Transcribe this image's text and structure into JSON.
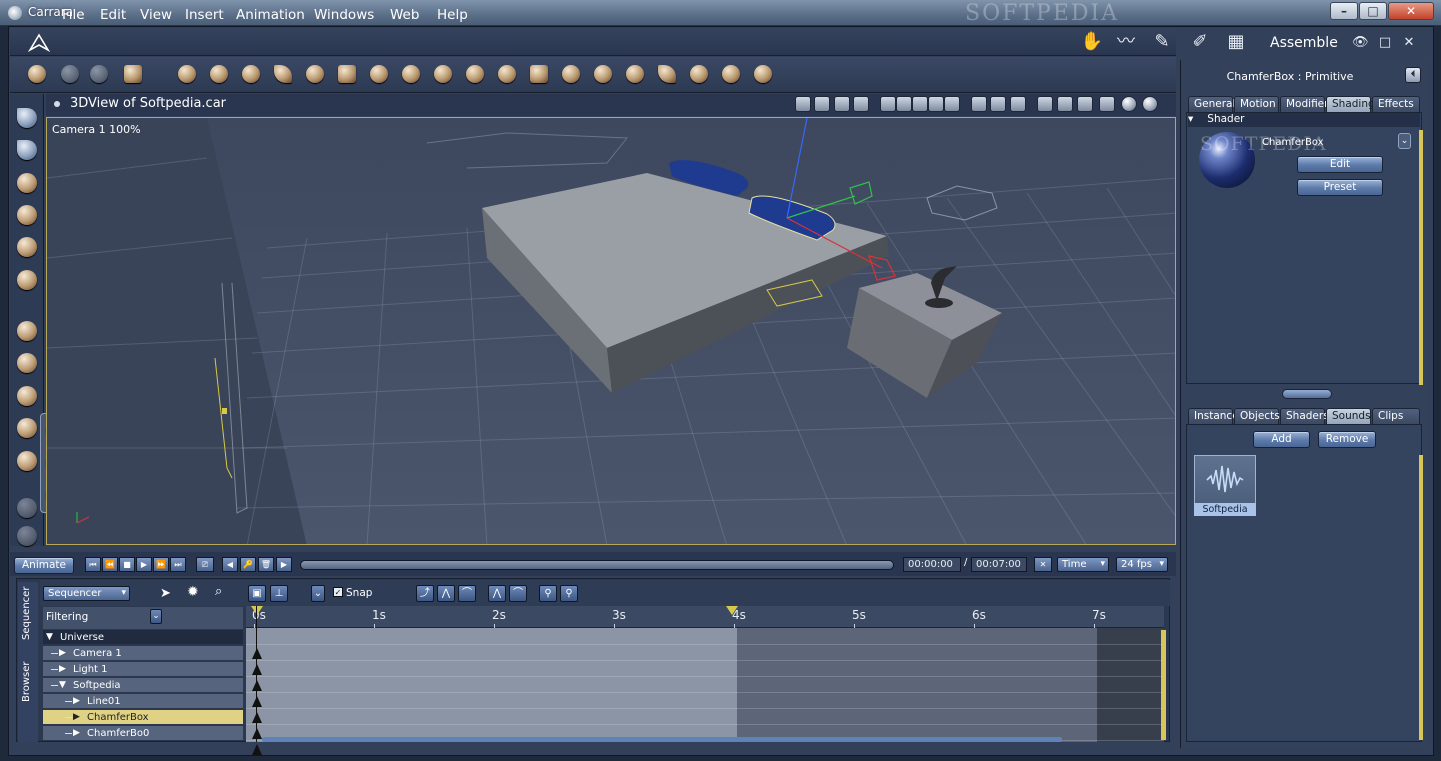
{
  "window": {
    "title": "Carrara",
    "watermark": "SOFTPEDIA",
    "controls": {
      "minimize": "–",
      "maximize": "□",
      "close": "✕"
    }
  },
  "menu": [
    "File",
    "Edit",
    "View",
    "Insert",
    "Animation",
    "Windows",
    "Web",
    "Help"
  ],
  "room": {
    "label": "Assemble",
    "icons": [
      "hand-icon",
      "spline-icon",
      "model-icon",
      "storyboard-icon",
      "render-icon"
    ]
  },
  "inner_controls": {
    "view": "👁",
    "maximize": "□",
    "close": "✕"
  },
  "toolbar_icons": [
    "move-tool-icon",
    "hand-tool-icon",
    "spline-tool-icon",
    "brush-tool-icon",
    "sphere-icon",
    "goblet-icon",
    "globe-icon",
    "bones-icon",
    "torus-icon",
    "text-icon",
    "gear-icon",
    "terrain-icon",
    "plant-icon",
    "cloud-icon",
    "fire-icon",
    "ground-icon",
    "grass-icon",
    "bowl-icon",
    "hammer-icon",
    "camera-icon",
    "particles-icon",
    "target-icon",
    "bone-icon"
  ],
  "left_tools": [
    "select-arrow-icon",
    "move-arrow-icon",
    "rotate-icon",
    "twist-icon",
    "pen-icon",
    "hand-grab-icon",
    "move-plane-icon",
    "move-axis-icon",
    "move-3d-icon",
    "scale-icon",
    "shade-icon",
    "camera-icon",
    "pan-hand-icon"
  ],
  "view": {
    "title": "3DView of Softpedia.car",
    "camera": "Camera 1 100%"
  },
  "right": {
    "title": "ChamferBox : Primitive",
    "pin_icon": "⏴",
    "tabs_top": [
      "General",
      "Motion",
      "Modifier",
      "Shading",
      "Effects"
    ],
    "active_top": "Shading",
    "shader_header": "Shader",
    "shader_name": "ChamferBox",
    "shader_watermark": "SOFTPEDIA",
    "edit_label": "Edit",
    "preset_label": "Preset",
    "tabs_bottom": [
      "Instance",
      "Objects",
      "Shaders",
      "Sounds",
      "Clips"
    ],
    "active_bottom": "Sounds",
    "add_label": "Add",
    "remove_label": "Remove",
    "sound_item": "Softpedia"
  },
  "sequencer_bar": {
    "animate_label": "Animate",
    "transport": [
      "⏮",
      "⏪",
      "■",
      "▶",
      "⏩",
      "⏭"
    ],
    "keys": [
      "◀",
      "🔑",
      "🗑",
      "▶"
    ],
    "current_time": "00:00:00",
    "separator": "/",
    "end_time": "00:07:00",
    "time_mode": "Time",
    "fps": "24 fps"
  },
  "sequencer": {
    "side_tabs": [
      "Sequencer",
      "Browser"
    ],
    "mode": "Sequencer",
    "snap_label": "Snap",
    "filter_label": "Filtering",
    "tree": [
      {
        "label": "Universe",
        "indent": 0,
        "expanded": true
      },
      {
        "label": "Camera 1",
        "indent": 1
      },
      {
        "label": "Light 1",
        "indent": 1
      },
      {
        "label": "Softpedia",
        "indent": 1,
        "expanded": true
      },
      {
        "label": "Line01",
        "indent": 2
      },
      {
        "label": "ChamferBox",
        "indent": 2,
        "selected": true
      },
      {
        "label": "ChamferBo0",
        "indent": 2
      }
    ],
    "ticks": [
      "0s",
      "1s",
      "2s",
      "3s",
      "4s",
      "5s",
      "6s",
      "7s"
    ]
  }
}
